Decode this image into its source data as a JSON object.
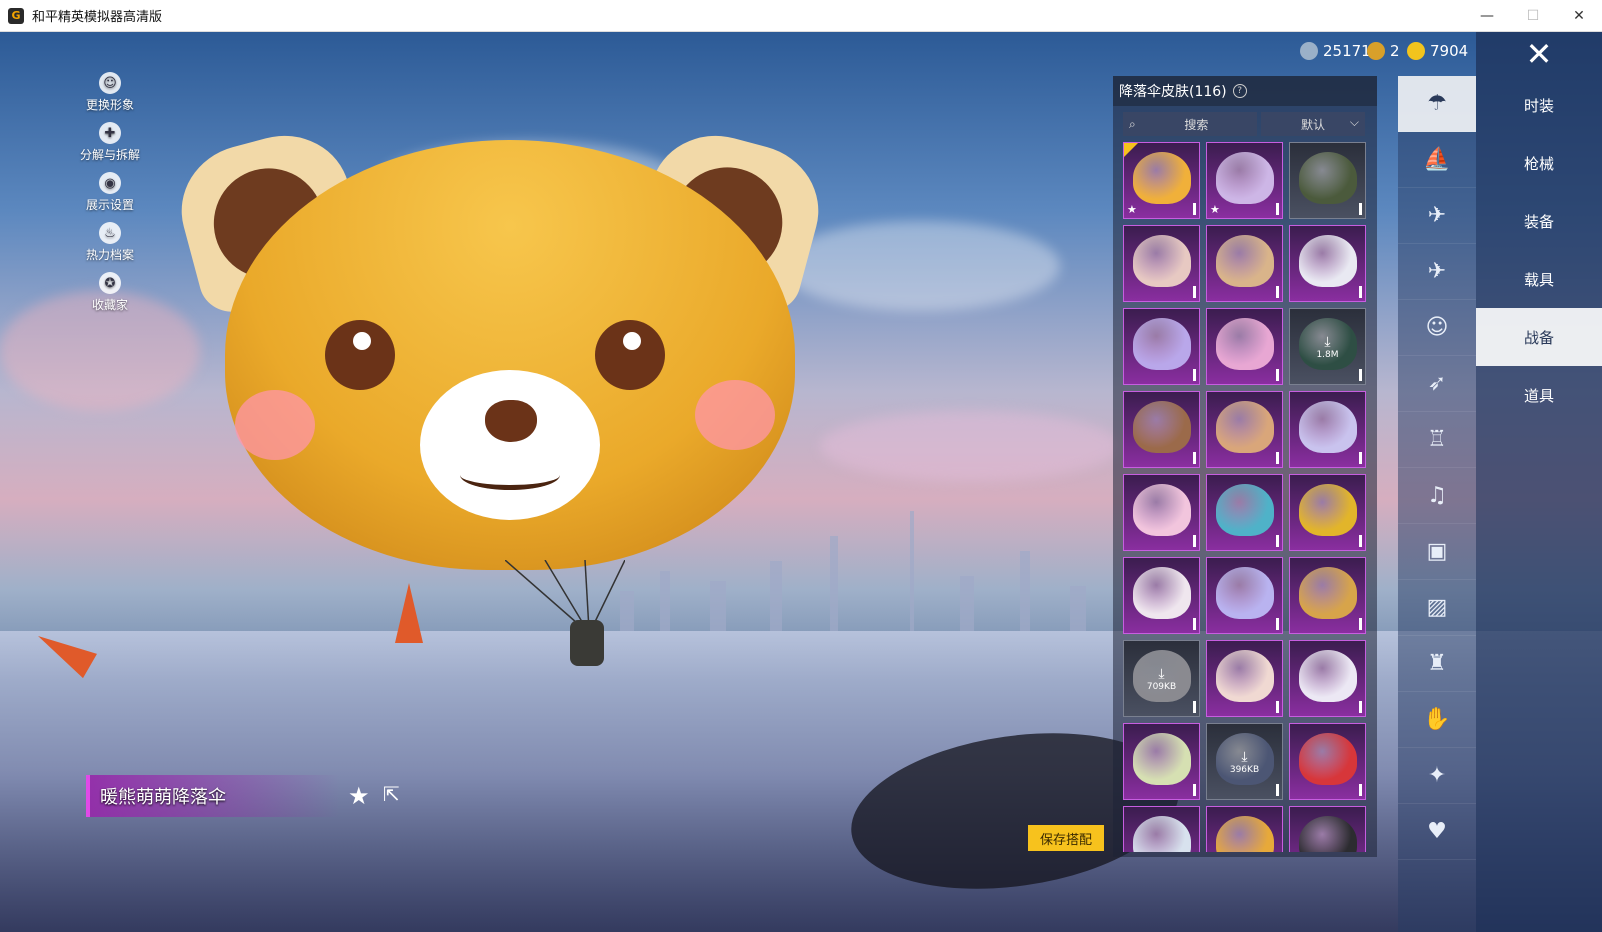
{
  "window": {
    "title": "和平精英模拟器高清版",
    "icon": "G"
  },
  "controls": {
    "minimize": "—",
    "maximize": "☐",
    "close": "✕"
  },
  "left_menu": [
    {
      "label": "更换形象",
      "icon": "person-icon"
    },
    {
      "label": "分解与拆解",
      "icon": "puzzle-icon"
    },
    {
      "label": "展示设置",
      "icon": "eye-icon"
    },
    {
      "label": "热力档案",
      "icon": "flame-icon"
    },
    {
      "label": "收藏家",
      "icon": "collector-badge-icon"
    }
  ],
  "currency": [
    {
      "value": "25171",
      "color": "#9ab0c8",
      "icon": "silver-coin-icon"
    },
    {
      "value": "2",
      "color": "#d8a02a",
      "icon": "bronze-coin-icon"
    },
    {
      "value": "7904",
      "color": "#f2c41d",
      "icon": "gold-coin-icon"
    }
  ],
  "panel": {
    "title": "降落伞皮肤(116)",
    "search_label": "搜索",
    "sort_label": "默认"
  },
  "selected_item": {
    "name": "暖熊萌萌降落伞"
  },
  "save_button": "保存搭配",
  "grid_items": [
    {
      "color": "#f0b03a",
      "star": "★",
      "new": true
    },
    {
      "color": "#cdb6e6",
      "star": "★"
    },
    {
      "color": "#4b5a3c",
      "grey": true
    },
    {
      "color": "#e7c9c2"
    },
    {
      "color": "#d9b48a"
    },
    {
      "color": "#e9e9f2"
    },
    {
      "color": "#b9a7ea"
    },
    {
      "color": "#e8a7d3"
    },
    {
      "color": "#2e4e44",
      "download": "1.8M",
      "grey": true
    },
    {
      "color": "#9b6a4a"
    },
    {
      "color": "#d9a67a"
    },
    {
      "color": "#c9c3ee"
    },
    {
      "color": "#f2c5dd"
    },
    {
      "color": "#4fb2c8"
    },
    {
      "color": "#e2b52a"
    },
    {
      "color": "#efe6ee"
    },
    {
      "color": "#b9b3f0"
    },
    {
      "color": "#d7a44a"
    },
    {
      "color": "#8a8a90",
      "download": "709KB",
      "grey": true
    },
    {
      "color": "#f0d9d2"
    },
    {
      "color": "#ece8f4"
    },
    {
      "color": "#d6e0b2"
    },
    {
      "color": "#4c5674",
      "download": "396KB",
      "grey": true
    },
    {
      "color": "#d7363a"
    },
    {
      "color": "#d8e2ee"
    },
    {
      "color": "#e7a93a"
    },
    {
      "color": "#2c2c30"
    }
  ],
  "categories": [
    {
      "icon": "parachute-icon",
      "active": true
    },
    {
      "icon": "boat-icon"
    },
    {
      "icon": "drone-icon"
    },
    {
      "icon": "plane-icon"
    },
    {
      "icon": "emote-face-icon"
    },
    {
      "icon": "glider-icon"
    },
    {
      "icon": "robot-icon"
    },
    {
      "icon": "speaker-icon"
    },
    {
      "icon": "chat-bubble-icon"
    },
    {
      "icon": "photo-icon"
    },
    {
      "icon": "spray-icon"
    },
    {
      "icon": "hand-icon"
    },
    {
      "icon": "magic-wand-icon"
    },
    {
      "icon": "chicken-icon"
    }
  ],
  "tabs": [
    "时装",
    "枪械",
    "装备",
    "载具",
    "战备",
    "道具"
  ],
  "active_tab": "战备"
}
